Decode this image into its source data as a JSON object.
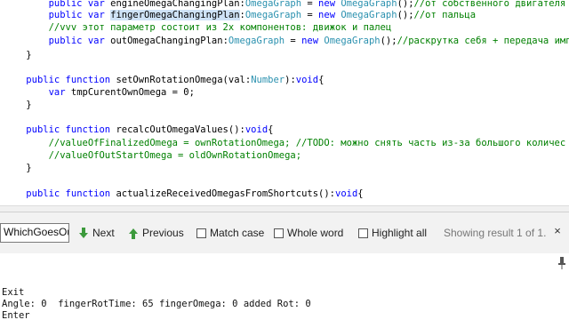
{
  "editor": {
    "lines": [
      {
        "indent": "        ",
        "kw": "public var ",
        "name": "engineOmegaChangingPlan",
        "colon": ":",
        "type": "OmegaGraph",
        "rest": " = ",
        "kw2": "new ",
        "type2": "OmegaGraph",
        "tail": "();",
        "comment": "//от собственного двигателя"
      },
      {
        "indent": "        ",
        "kw": "public var ",
        "name": "fingerOmegaChangingPlan",
        "colon": ":",
        "type": "OmegaGraph",
        "rest": " = ",
        "kw2": "new ",
        "type2": "OmegaGraph",
        "tail": "();",
        "comment": "//от пальца"
      },
      {
        "indent": "        ",
        "comment_only": "//vvv этот параметр состоит из 2х компонентов: движок и палец"
      },
      {
        "indent": "        ",
        "kw": "public var ",
        "name": "outOmegaChangingPlan",
        "colon": ":",
        "type": "OmegaGraph",
        "rest": " = ",
        "kw2": "new ",
        "type2": "OmegaGraph",
        "tail": "();",
        "comment": "//раскрутка себя + передача имп"
      },
      {
        "indent": "    ",
        "plain": "}"
      },
      {
        "indent": "",
        "plain": ""
      },
      {
        "indent": "    ",
        "kw": "public function ",
        "name": "setOwnRotationOmega(val",
        "colon": ":",
        "type": "Number",
        "rest": "):",
        "kw2": "void",
        "type2": "",
        "tail": "{",
        "comment": ""
      },
      {
        "indent": "        ",
        "kw": "var ",
        "name": "tmpCurentOwnOmega",
        "colon": "",
        "type": "",
        "rest": " = 0;",
        "kw2": "",
        "type2": "",
        "tail": "",
        "comment": ""
      },
      {
        "indent": "    ",
        "plain": "}"
      },
      {
        "indent": "",
        "plain": ""
      },
      {
        "indent": "    ",
        "kw": "public function ",
        "name": "recalcOutOmegaValues():",
        "colon": "",
        "type": "",
        "rest": "",
        "kw2": "void",
        "type2": "",
        "tail": "{",
        "comment": ""
      },
      {
        "indent": "        ",
        "comment_only": "//valueOfFinalizedOmega = ownRotationOmega; //TODO: можно снять часть из-за большого количес"
      },
      {
        "indent": "        ",
        "comment_only": "//valueOfOutStartOmega = oldOwnRotationOmega;"
      },
      {
        "indent": "    ",
        "plain": "}"
      },
      {
        "indent": "",
        "plain": ""
      },
      {
        "indent": "    ",
        "kw": "public function ",
        "name": "actualizeReceivedOmegasFromShortcuts():",
        "colon": "",
        "type": "",
        "rest": "",
        "kw2": "void",
        "type2": "",
        "tail": "{",
        "comment": ""
      }
    ]
  },
  "find_bar": {
    "search_value": "WhichGoesOut",
    "next_label": "Next",
    "previous_label": "Previous",
    "match_case_label": "Match case",
    "whole_word_label": "Whole word",
    "highlight_all_label": "Highlight all",
    "status": "Showing result 1 of 1.",
    "close_glyph": "×",
    "arrow_color": "#3c9a3c"
  },
  "console": {
    "lines": [
      "Exit",
      "Angle: 0  fingerRotTime: 65 fingerOmega: 0 added Rot: 0",
      "Enter"
    ]
  }
}
